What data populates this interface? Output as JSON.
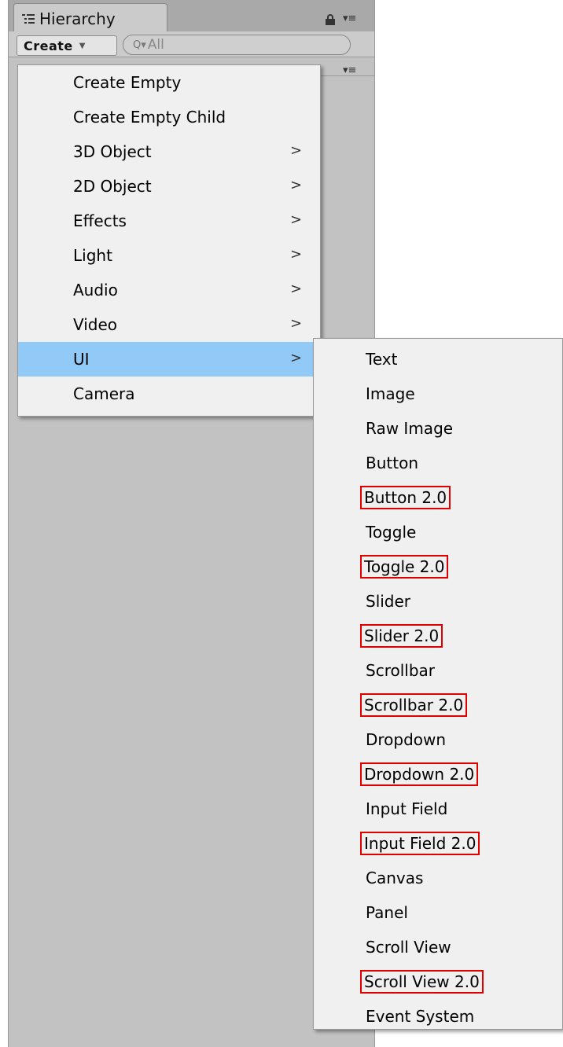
{
  "panel": {
    "tab_title": "Hierarchy",
    "tab_icon": "hierarchy-list-icon",
    "lock_icon": "lock-icon",
    "options_icon": "panel-menu-icon",
    "create_label": "Create",
    "search_placeholder": "All"
  },
  "context_menu": {
    "items": [
      {
        "label": "Create Empty",
        "submenu": false
      },
      {
        "label": "Create Empty Child",
        "submenu": false
      },
      {
        "label": "3D Object",
        "submenu": true
      },
      {
        "label": "2D Object",
        "submenu": true
      },
      {
        "label": "Effects",
        "submenu": true
      },
      {
        "label": "Light",
        "submenu": true
      },
      {
        "label": "Audio",
        "submenu": true
      },
      {
        "label": "Video",
        "submenu": true
      },
      {
        "label": "UI",
        "submenu": true,
        "selected": true
      },
      {
        "label": "Camera",
        "submenu": false
      }
    ],
    "submenu_arrow": ">"
  },
  "ui_submenu": {
    "items": [
      {
        "label": "Text",
        "highlighted": false
      },
      {
        "label": "Image",
        "highlighted": false
      },
      {
        "label": "Raw Image",
        "highlighted": false
      },
      {
        "label": "Button",
        "highlighted": false
      },
      {
        "label": "Button 2.0",
        "highlighted": true
      },
      {
        "label": "Toggle",
        "highlighted": false
      },
      {
        "label": "Toggle 2.0",
        "highlighted": true
      },
      {
        "label": "Slider",
        "highlighted": false
      },
      {
        "label": "Slider 2.0",
        "highlighted": true
      },
      {
        "label": "Scrollbar",
        "highlighted": false
      },
      {
        "label": "Scrollbar 2.0",
        "highlighted": true
      },
      {
        "label": "Dropdown",
        "highlighted": false
      },
      {
        "label": "Dropdown 2.0",
        "highlighted": true
      },
      {
        "label": "Input Field",
        "highlighted": false
      },
      {
        "label": "Input Field 2.0",
        "highlighted": true
      },
      {
        "label": "Canvas",
        "highlighted": false
      },
      {
        "label": "Panel",
        "highlighted": false
      },
      {
        "label": "Scroll View",
        "highlighted": false
      },
      {
        "label": "Scroll View 2.0",
        "highlighted": true
      },
      {
        "label": "Event System",
        "highlighted": false
      }
    ]
  },
  "colors": {
    "selected_row": "#91c9f7",
    "highlight_box": "#e00000",
    "menu_bg": "#f0f0f0",
    "panel_bg": "#c2c2c2"
  }
}
